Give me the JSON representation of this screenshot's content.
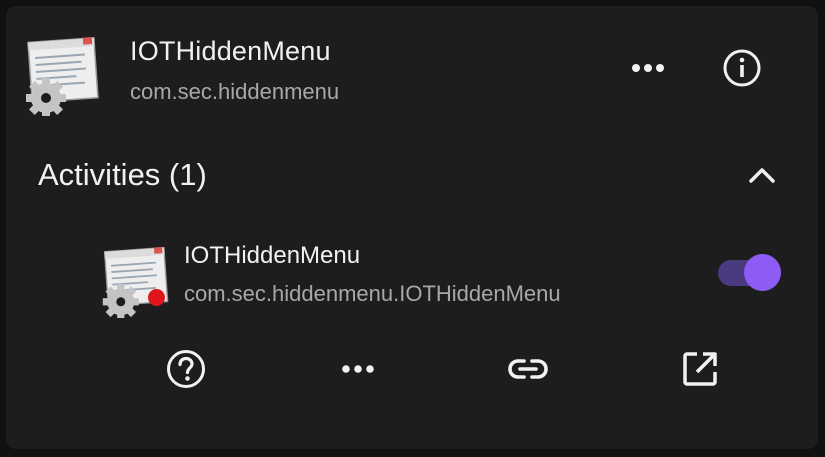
{
  "app": {
    "name": "IOTHiddenMenu",
    "package": "com.sec.hiddenmenu",
    "icon": "settings-window-gear-icon"
  },
  "header_actions": {
    "more_icon": "more-horizontal-icon",
    "info_icon": "info-icon"
  },
  "activities_section": {
    "title": "Activities (1)",
    "collapse_icon": "chevron-up-icon",
    "items": [
      {
        "name": "IOTHiddenMenu",
        "class_name": "com.sec.hiddenmenu.IOTHiddenMenu",
        "icon": "settings-window-gear-icon",
        "status_dot_color": "#e0161d",
        "enabled": true
      }
    ]
  },
  "item_actions": {
    "help_icon": "help-circle-icon",
    "more_icon": "more-horizontal-icon",
    "link_icon": "link-icon",
    "open_icon": "open-external-icon"
  },
  "colors": {
    "background": "#111111",
    "card": "#1d1d1d",
    "primary_text": "#f1f1f1",
    "secondary_text": "#a8a8a8",
    "toggle_track": "#4a3a7f",
    "toggle_thumb": "#8c5cf5"
  }
}
